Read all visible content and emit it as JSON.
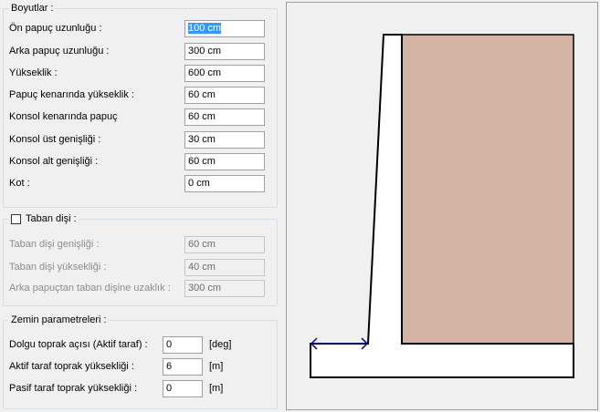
{
  "dimensions": {
    "legend": "Boyutlar :",
    "fields": [
      {
        "label": "Ön papuç uzunluğu :",
        "value": "100 cm"
      },
      {
        "label": "Arka papuç uzunluğu :",
        "value": "300 cm"
      },
      {
        "label": "Yükseklik :",
        "value": "600 cm"
      },
      {
        "label": "Papuç kenarında yükseklik :",
        "value": "60 cm"
      },
      {
        "label": "Konsol kenarında papuç",
        "value": "60 cm"
      },
      {
        "label": "Konsol üst genişliği :",
        "value": "30 cm"
      },
      {
        "label": "Konsol alt genişliği :",
        "value": "60 cm"
      },
      {
        "label": "Kot :",
        "value": "0 cm"
      }
    ]
  },
  "key": {
    "legend": "Taban dişi :",
    "checked": false,
    "fields": [
      {
        "label": "Taban dişi genişliği :",
        "value": "60 cm"
      },
      {
        "label": "Taban dişi yüksekliği :",
        "value": "40 cm"
      },
      {
        "label": "Arka papuçtan taban dişine uzaklık :",
        "value": "300 cm"
      }
    ]
  },
  "soil": {
    "legend": "Zemin parametreleri :",
    "fields": [
      {
        "label": "Dolgu toprak açısı (Aktif taraf) :",
        "value": "0",
        "unit": "[deg]"
      },
      {
        "label": "Aktif taraf toprak yüksekliği :",
        "value": "6",
        "unit": "[m]"
      },
      {
        "label": "Pasif taraf toprak yüksekliği :",
        "value": "0",
        "unit": "[m]"
      }
    ]
  },
  "drawing": {
    "soil_color": "#d4b4a4",
    "arrow_color": "#00008b"
  }
}
